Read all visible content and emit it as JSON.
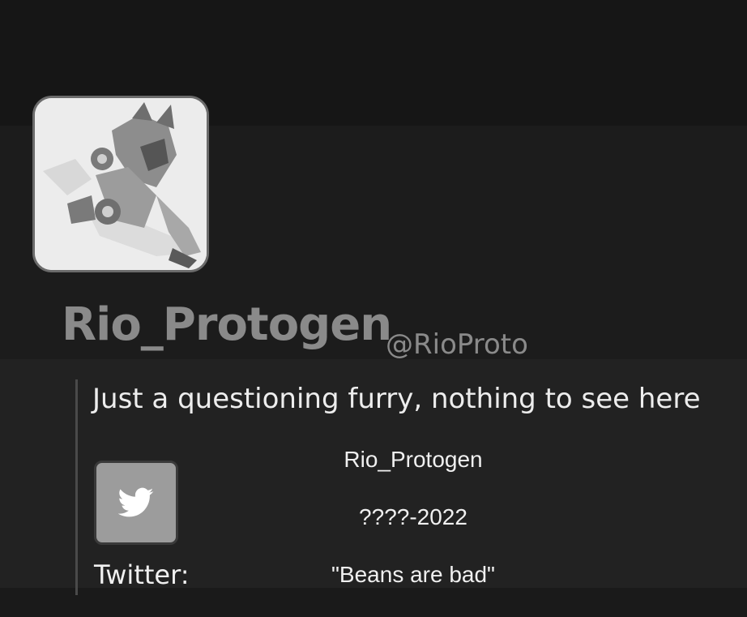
{
  "profile": {
    "display_name": "Rio_Protogen",
    "handle": "@RioProto",
    "bio": "Just a questioning furry, nothing to see here",
    "avatar_alt": "protogen-character-artwork"
  },
  "social": {
    "twitter_icon": "twitter-bird-icon",
    "twitter_label": "Twitter:"
  },
  "info": {
    "name": "Rio_Protogen",
    "years": "????-2022",
    "quote": "\"Beans are bad\""
  },
  "colors": {
    "background": "#1b1b1b",
    "name_text": "#8a8a8a",
    "body_text": "#f0f0f0",
    "icon_button": "#9c9c9c"
  }
}
